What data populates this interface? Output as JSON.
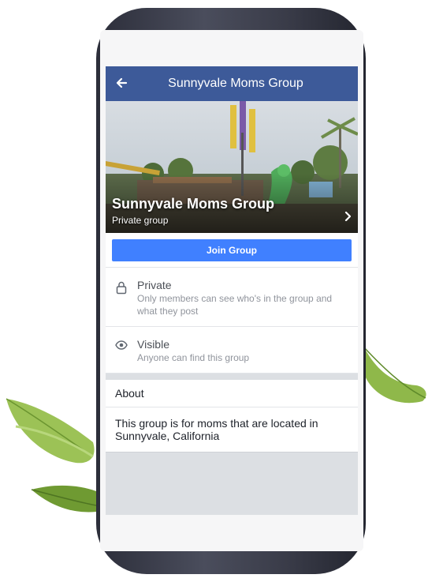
{
  "header": {
    "title": "Sunnyvale Moms Group"
  },
  "cover": {
    "group_name": "Sunnyvale Moms Group",
    "group_type": "Private group"
  },
  "join_button": {
    "label": "Join Group"
  },
  "privacy": {
    "title": "Private",
    "description": "Only members can see who's in the group and what they post"
  },
  "visibility": {
    "title": "Visible",
    "description": "Anyone can find this group"
  },
  "about": {
    "heading": "About",
    "text": "This group is for moms that are located in Sunnyvale, California"
  },
  "colors": {
    "navbar": "#3d5a99",
    "join_button": "#4080ff",
    "page_bg": "#dcdfe3"
  },
  "icons": {
    "back": "arrow-left-icon",
    "next": "chevron-right-icon",
    "private": "lock-icon",
    "visible": "eye-icon"
  }
}
